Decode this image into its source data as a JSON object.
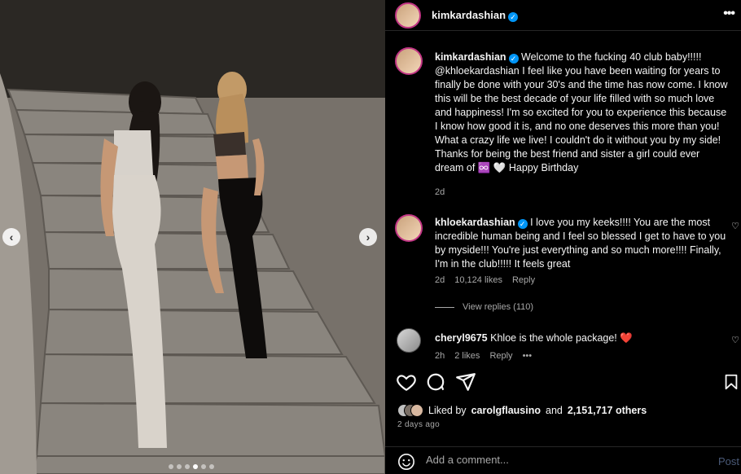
{
  "post": {
    "author": "kimkardashian",
    "caption": "Welcome to the fucking 40 club baby!!!!! @khloekardashian I feel like you have been waiting for years to finally be done with your 30's and the time has now come. I know this will be the best decade of your life filled with so much love and happiness! I'm so excited for you to experience this because I know how good it is, and no one deserves this more than you! What a crazy life we live! I couldn't do it without you by my side! Thanks for being the best friend and sister a girl could ever dream of ♾️ 🤍 Happy Birthday",
    "caption_time": "2d"
  },
  "comments": [
    {
      "author": "khloekardashian",
      "text": "I love you my keeks!!!! You are the most incredible human being and I feel so blessed I get to have to you by myside!!! You're just everything and so much more!!!! Finally, I'm in the club!!!!! It feels great",
      "time": "2d",
      "likes": "10,124 likes",
      "reply": "Reply"
    },
    {
      "author": "cheryl9675",
      "text": "Khloe is the whole package! ❤️",
      "time": "2h",
      "likes": "2 likes",
      "reply": "Reply",
      "more": "•••"
    }
  ],
  "view_replies": "View replies (110)",
  "liked_by": {
    "prefix": "Liked by",
    "user": "carolgflausino",
    "middle": "and",
    "count": "2,151,717 others"
  },
  "time_ago": "2 days ago",
  "add_comment": {
    "placeholder": "Add a comment...",
    "post_label": "Post"
  },
  "carousel": {
    "nav_prev": "‹",
    "nav_next": "›",
    "slide_count": 6,
    "active_index": 3
  },
  "colors": {
    "verified": "#0095f6",
    "story_ring": "#c13584",
    "muted": "#a8a8a8"
  }
}
